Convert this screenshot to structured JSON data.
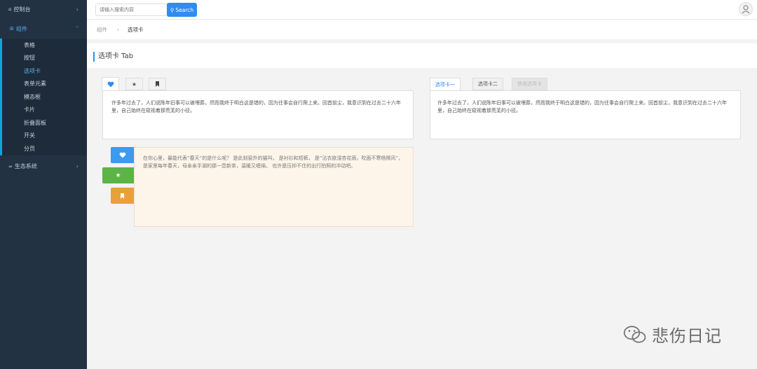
{
  "sidebar": {
    "dashboard": "控制台",
    "group": "组件",
    "items": [
      {
        "label": "表格",
        "active": false
      },
      {
        "label": "按钮",
        "active": false
      },
      {
        "label": "选项卡",
        "active": true
      },
      {
        "label": "表单元素",
        "active": false
      },
      {
        "label": "模态框",
        "active": false
      },
      {
        "label": "卡片",
        "active": false
      },
      {
        "label": "折叠面板",
        "active": false
      },
      {
        "label": "开关",
        "active": false
      },
      {
        "label": "分页",
        "active": false
      }
    ],
    "ecosystem": "生态系统",
    "accent": "#12a4dc"
  },
  "header": {
    "search_placeholder": "请输入搜索内容",
    "search_button": "Search"
  },
  "breadcrumb": {
    "parent": "组件",
    "separator": "›",
    "current": "选项卡"
  },
  "page": {
    "title": "选项卡 Tab"
  },
  "tabs_icon": {
    "icons": [
      "heart-icon",
      "star-icon",
      "bookmark-icon"
    ],
    "content": "许多年过去了，人们说陈年旧事可以被埋葬，然而我终于明白这是错的，因为往事会自行爬上来。回首前尘，我意识到在过去二十六年里，自己始终在窥视着那荒芜的小径。"
  },
  "tabs_text": {
    "tabs": [
      "选项卡一",
      "选项卡二",
      "禁用选项卡"
    ],
    "content": "许多年过去了，人们说陈年旧事可以被埋葬，然而我终于明白这是错的，因为往事会自行爬上来。回首前尘，我意识到在过去二十六年里，自己始终在窥视着那荒芜的小径。"
  },
  "tabs_vertical": {
    "colors": [
      "#3a9bf0",
      "#5ab546",
      "#e8a13a"
    ],
    "content": "在你心里，最能代表“春天”的是什么呢？ 是此刻窗外的猫叫， 是衬衫和短裤， 是“沾衣欲湿杏花雨，吹面不寒杨柳风”， 是家里每年春天，母亲亲手湖的那一壶新茶，温暖又缠绵。 也许是压抑不住的出行拍照的冲动吧。"
  },
  "watermark": {
    "text": "悲伤日记"
  }
}
